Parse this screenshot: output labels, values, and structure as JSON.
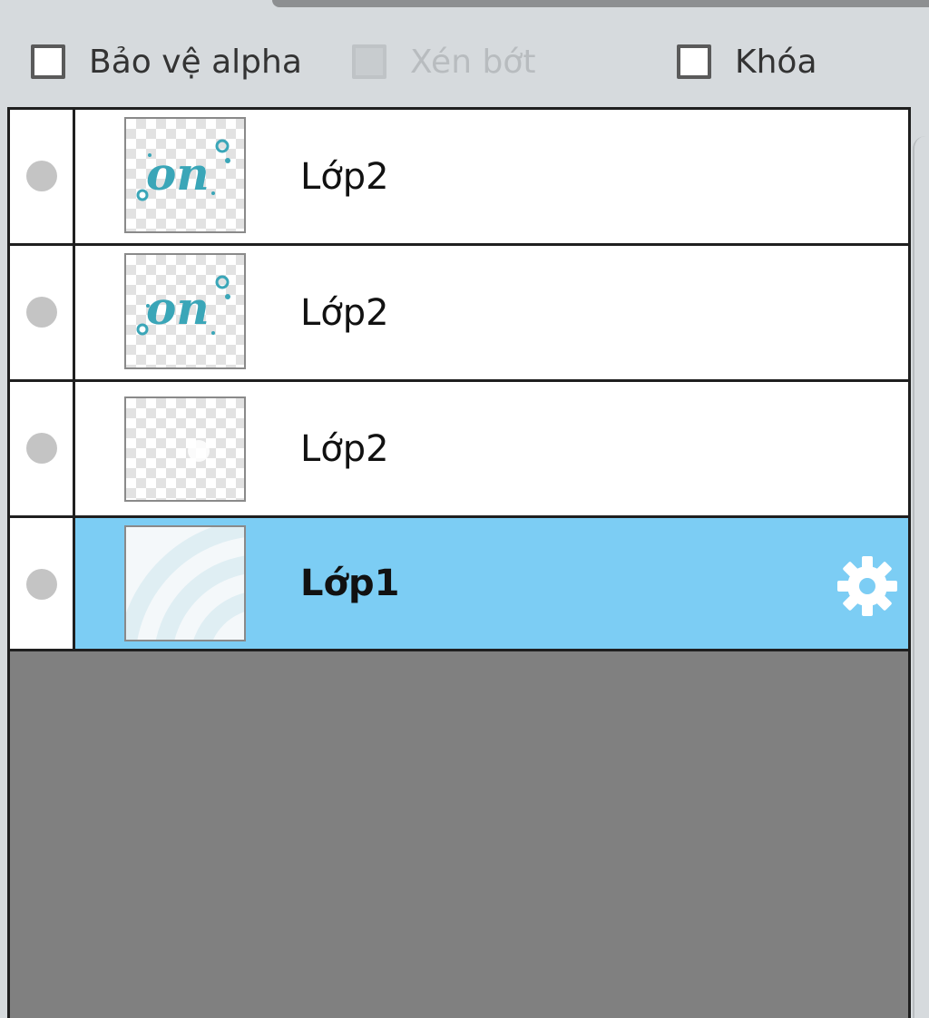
{
  "options": {
    "protect_alpha": {
      "label": "Bảo vệ alpha",
      "checked": false,
      "enabled": true
    },
    "clip": {
      "label": "Xén bớt",
      "checked": false,
      "enabled": false
    },
    "lock": {
      "label": "Khóa",
      "checked": false,
      "enabled": true
    }
  },
  "layers": [
    {
      "name": "Lớp2",
      "thumbnail": "text-on-icon",
      "selected": false
    },
    {
      "name": "Lớp2",
      "thumbnail": "text-on-icon",
      "selected": false
    },
    {
      "name": "Lớp2",
      "thumbnail": "transparent",
      "selected": false
    },
    {
      "name": "Lớp1",
      "thumbnail": "concentric-arcs",
      "selected": true
    }
  ],
  "icons": {
    "settings": "gear-icon",
    "visibility": "visibility-dot-icon"
  },
  "colors": {
    "selected_row": "#7ccdf4",
    "thumbnail_art": "#3aa6b8",
    "empty_area": "#808080"
  }
}
